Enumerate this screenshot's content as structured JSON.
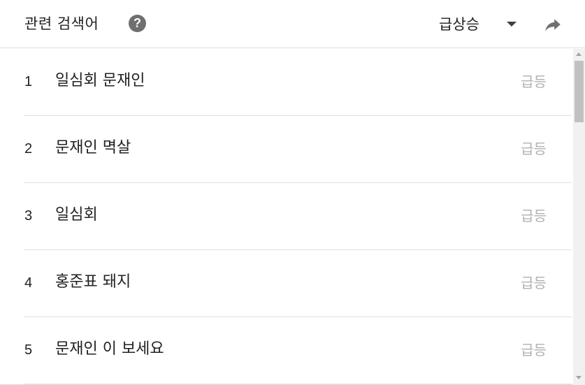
{
  "header": {
    "title": "관련 검색어",
    "help_icon": "help-icon",
    "help_glyph": "?",
    "sort_label": "급상승",
    "dropdown_icon": "dropdown-triangle-icon",
    "share_icon": "share-arrow-icon"
  },
  "items": [
    {
      "rank": "1",
      "query": "일심회 문재인",
      "value": "급등"
    },
    {
      "rank": "2",
      "query": "문재인 멱살",
      "value": "급등"
    },
    {
      "rank": "3",
      "query": "일심회",
      "value": "급등"
    },
    {
      "rank": "4",
      "query": "홍준표 돼지",
      "value": "급등"
    },
    {
      "rank": "5",
      "query": "문재인 이 보세요",
      "value": "급등"
    }
  ],
  "colors": {
    "text": "#202124",
    "muted_value": "#b0b0b0",
    "icon_gray": "#6f6f6f",
    "divider": "#e0e0e0"
  }
}
